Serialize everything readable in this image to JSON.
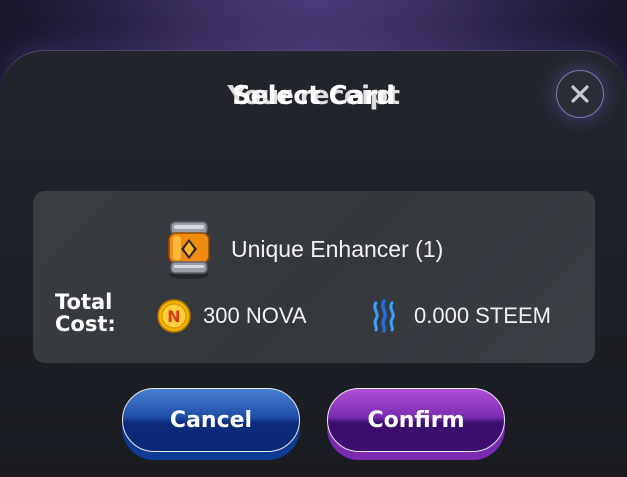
{
  "dialog": {
    "title": "Select Card",
    "title_overlay": "Your receipt"
  },
  "item": {
    "icon": "enhancer-canister-icon",
    "name": "Unique Enhancer (1)"
  },
  "cost": {
    "label": "Total Cost:",
    "nova_icon": "nova-coin-icon",
    "nova_amount": "300 NOVA",
    "steem_icon": "steem-logo-icon",
    "steem_amount": "0.000 STEEM"
  },
  "actions": {
    "cancel_label": "Cancel",
    "confirm_label": "Confirm"
  },
  "colors": {
    "cancel_button": "#1e4fa8",
    "confirm_button": "#7b2cb0",
    "nova_coin": "#f2b400",
    "steem": "#2a8cf0"
  }
}
